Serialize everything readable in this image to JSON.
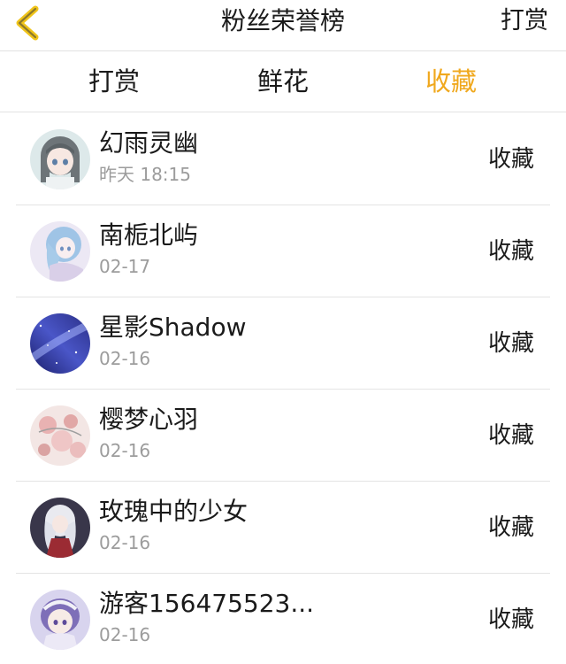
{
  "header": {
    "title": "粉丝荣誉榜",
    "right_label": "打赏",
    "back_icon": "chevron-left-icon",
    "accent_color": "#f0a81d"
  },
  "tabs": [
    {
      "label": "打赏",
      "active": false
    },
    {
      "label": "鲜花",
      "active": false
    },
    {
      "label": "收藏",
      "active": true
    }
  ],
  "fans": [
    {
      "name": "幻雨灵幽",
      "date": "昨天 18:15",
      "action": "收藏",
      "avatar": "anime-girl-avatar"
    },
    {
      "name": "南栀北屿",
      "date": "02-17",
      "action": "收藏",
      "avatar": "anime-girl-avatar"
    },
    {
      "name": "星影Shadow",
      "date": "02-16",
      "action": "收藏",
      "avatar": "galaxy-avatar"
    },
    {
      "name": "樱梦心羽",
      "date": "02-16",
      "action": "收藏",
      "avatar": "illustration-avatar"
    },
    {
      "name": "玫瑰中的少女",
      "date": "02-16",
      "action": "收藏",
      "avatar": "anime-girl-avatar"
    },
    {
      "name": "游客156475523...",
      "date": "02-16",
      "action": "收藏",
      "avatar": "anime-girl-avatar"
    }
  ]
}
